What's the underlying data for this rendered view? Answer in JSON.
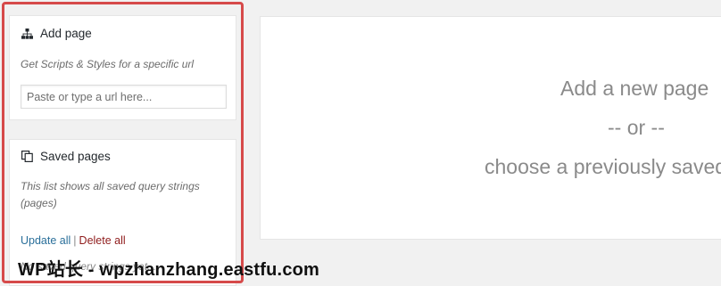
{
  "add_page": {
    "icon": "sitemap-icon",
    "title": "Add page",
    "description": "Get Scripts & Styles for a specific url",
    "url_input_placeholder": "Paste or type a url here..."
  },
  "saved_pages": {
    "icon": "copy-pages-icon",
    "title": "Saved pages",
    "description": "This list shows all saved query strings (pages)",
    "update_all_label": "Update all",
    "separator": "|",
    "delete_all_label": "Delete all",
    "empty_note": "No saved query strings yet..."
  },
  "main": {
    "line1": "Add a new page",
    "line2": "-- or --",
    "line3": "choose a previously saved page"
  },
  "watermark": {
    "text": "WP站长 - wpzhanzhang.eastfu.com"
  },
  "colors": {
    "highlight_frame": "#d64a4a",
    "link_update": "#2a6f9a",
    "link_delete": "#8f1c1c",
    "muted_text": "#8a8a8a",
    "background": "#f1f1f1"
  }
}
